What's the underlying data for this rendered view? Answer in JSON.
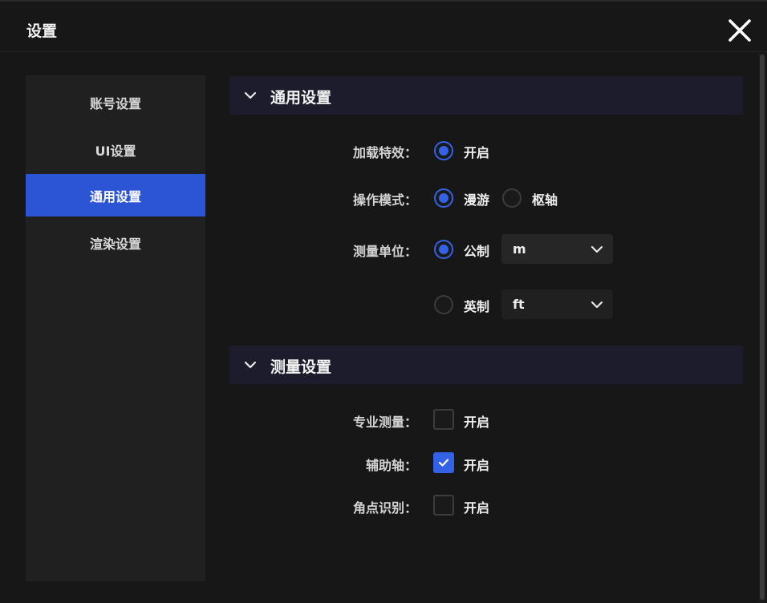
{
  "window": {
    "title": "设置"
  },
  "sidebar": {
    "items": [
      {
        "label": "账号设置"
      },
      {
        "label": "UI设置"
      },
      {
        "label": "通用设置",
        "active": true
      },
      {
        "label": "渲染设置"
      }
    ]
  },
  "general": {
    "header": "通用设置",
    "load_effects": {
      "label": "加载特效：",
      "option": "开启",
      "selected": true
    },
    "operation_mode": {
      "label": "操作模式：",
      "options": [
        "漫游",
        "枢轴"
      ],
      "selected": "漫游"
    },
    "measure_unit": {
      "label": "测量单位：",
      "metric": {
        "label": "公制",
        "selected": true,
        "value": "m"
      },
      "imperial": {
        "label": "英制",
        "selected": false,
        "value": "ft"
      }
    }
  },
  "measure": {
    "header": "测量设置",
    "professional": {
      "label": "专业测量：",
      "option": "开启",
      "checked": false
    },
    "aux_axis": {
      "label": "辅助轴：",
      "option": "开启",
      "checked": true
    },
    "corner_detect": {
      "label": "角点识别：",
      "option": "开启",
      "checked": false
    }
  },
  "colors": {
    "accent": "#2c55d6",
    "section_bg": "#1c1c2c",
    "background": "#171717"
  },
  "icons": {
    "close": "close-icon",
    "collapse": "chevron-down-icon",
    "check": "check-icon"
  }
}
